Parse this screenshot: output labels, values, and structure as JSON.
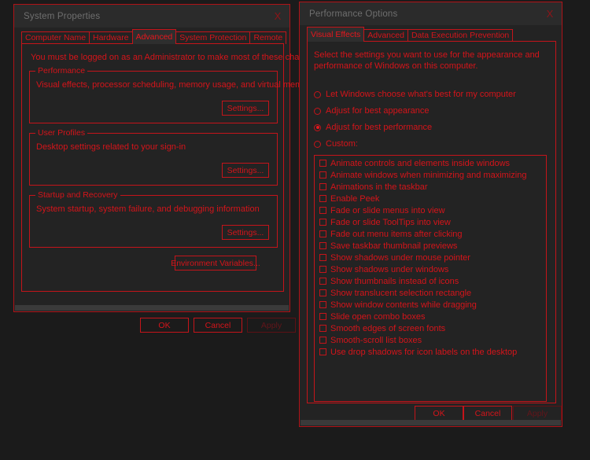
{
  "desktop": {
    "background": "#1b1b1b"
  },
  "theme": {
    "accent_red": "#d5141a",
    "border_red": "#c4141a",
    "window_bg": "#232323",
    "titlebar_bg": "#2b2b2b",
    "title_text": "#6f6f6f",
    "disabled_red": "#62151a"
  },
  "system_properties": {
    "title": "System Properties",
    "close_label": "X",
    "tabs": [
      {
        "label": "Computer Name",
        "active": false
      },
      {
        "label": "Hardware",
        "active": false
      },
      {
        "label": "Advanced",
        "active": true
      },
      {
        "label": "System Protection",
        "active": false
      },
      {
        "label": "Remote",
        "active": false
      }
    ],
    "admin_notice": "You must be logged on as an Administrator to make most of these changes.",
    "groups": [
      {
        "legend": "Performance",
        "description": "Visual effects, processor scheduling, memory usage, and virtual memory",
        "button": "Settings..."
      },
      {
        "legend": "User Profiles",
        "description": "Desktop settings related to your sign-in",
        "button": "Settings..."
      },
      {
        "legend": "Startup and Recovery",
        "description": "System startup, system failure, and debugging information",
        "button": "Settings..."
      }
    ],
    "environment_variables_button": "Environment Variables...",
    "footer": {
      "ok": "OK",
      "cancel": "Cancel",
      "apply": "Apply",
      "apply_disabled": true
    }
  },
  "performance_options": {
    "title": "Performance Options",
    "close_label": "X",
    "tabs": [
      {
        "label": "Visual Effects",
        "active": true
      },
      {
        "label": "Advanced",
        "active": false
      },
      {
        "label": "Data Execution Prevention",
        "active": false
      }
    ],
    "intro": "Select the settings you want to use for the appearance and performance of Windows on this computer.",
    "radios": [
      {
        "label": "Let Windows choose what's best for my computer",
        "checked": false
      },
      {
        "label": "Adjust for best appearance",
        "checked": false
      },
      {
        "label": "Adjust for best performance",
        "checked": true
      },
      {
        "label": "Custom:",
        "checked": false
      }
    ],
    "effects": [
      {
        "label": "Animate controls and elements inside windows",
        "checked": false
      },
      {
        "label": "Animate windows when minimizing and maximizing",
        "checked": false
      },
      {
        "label": "Animations in the taskbar",
        "checked": false
      },
      {
        "label": "Enable Peek",
        "checked": false
      },
      {
        "label": "Fade or slide menus into view",
        "checked": false
      },
      {
        "label": "Fade or slide ToolTips into view",
        "checked": false
      },
      {
        "label": "Fade out menu items after clicking",
        "checked": false
      },
      {
        "label": "Save taskbar thumbnail previews",
        "checked": false
      },
      {
        "label": "Show shadows under mouse pointer",
        "checked": false
      },
      {
        "label": "Show shadows under windows",
        "checked": false
      },
      {
        "label": "Show thumbnails instead of icons",
        "checked": false
      },
      {
        "label": "Show translucent selection rectangle",
        "checked": false
      },
      {
        "label": "Show window contents while dragging",
        "checked": false
      },
      {
        "label": "Slide open combo boxes",
        "checked": false
      },
      {
        "label": "Smooth edges of screen fonts",
        "checked": false
      },
      {
        "label": "Smooth-scroll list boxes",
        "checked": false
      },
      {
        "label": "Use drop shadows for icon labels on the desktop",
        "checked": false
      }
    ],
    "footer": {
      "ok": "OK",
      "cancel": "Cancel",
      "apply": "Apply",
      "apply_disabled": true
    }
  }
}
